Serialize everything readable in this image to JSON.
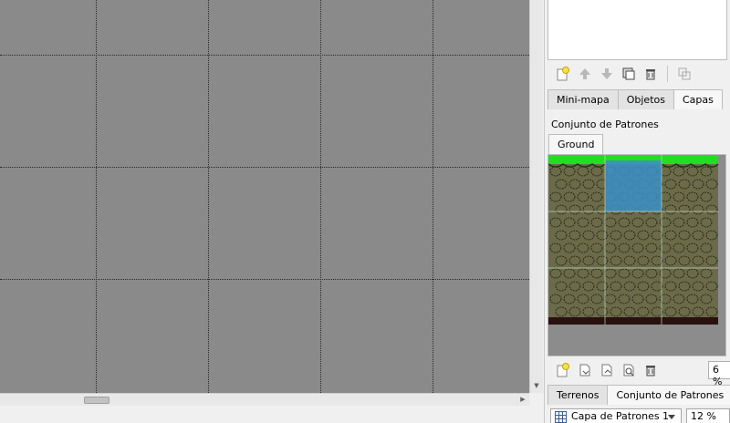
{
  "layers_panel": {
    "toolbar": [
      {
        "icon": "new-layer-icon"
      },
      {
        "icon": "arrow-up-icon"
      },
      {
        "icon": "arrow-down-icon"
      },
      {
        "icon": "duplicate-layer-icon"
      },
      {
        "icon": "delete-layer-icon"
      },
      {
        "icon": "toggle-view-icon"
      }
    ],
    "tabs": [
      {
        "label": "Mini-mapa"
      },
      {
        "label": "Objetos"
      },
      {
        "label": "Capas",
        "active": true
      }
    ]
  },
  "tileset_panel": {
    "title": "Conjunto de Patrones",
    "tab": "Ground",
    "zoom": "6 %",
    "toolbar": [
      {
        "icon": "new-tileset-icon"
      },
      {
        "icon": "import-tileset-icon"
      },
      {
        "icon": "export-tileset-icon"
      },
      {
        "icon": "tileset-properties-icon"
      },
      {
        "icon": "delete-tileset-icon"
      }
    ],
    "bottom_tabs": [
      {
        "label": "Terrenos"
      },
      {
        "label": "Conjunto de Patrones",
        "active": true
      }
    ]
  },
  "status_bar": {
    "layer_select": "Capa de Patrones 1",
    "zoom": "12 %"
  },
  "colors": {
    "map_background": "#8a8a8a",
    "tile_soil": "#6b6b4a",
    "tile_grass": "#22dd22",
    "tile_selection": "#3a8fc8",
    "tile_bottom": "#2a1010"
  }
}
